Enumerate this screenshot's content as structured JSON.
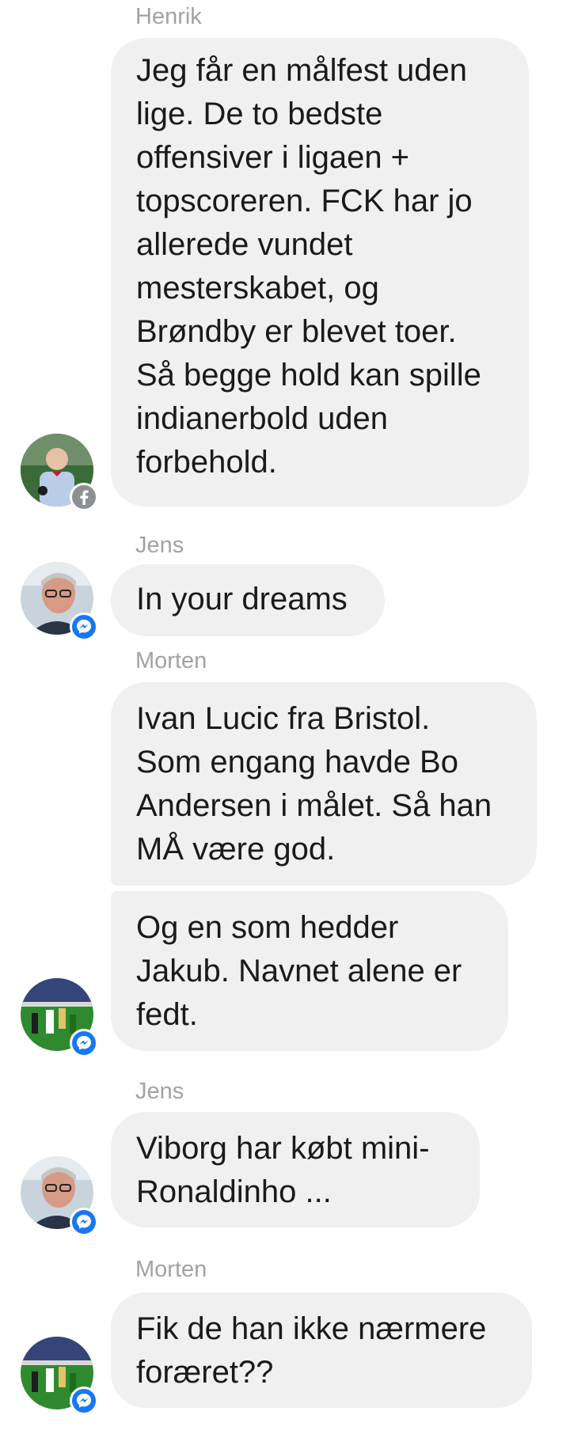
{
  "messages": [
    {
      "sender": "Henrik",
      "text": "Jeg får en målfest uden\nlige. De to bedste\noffensiver i ligaen +\ntopscoreren. FCK har jo\nallerede vundet\nmesterskabet, og\nBrøndby er blevet toer.\nSå begge hold kan spille\nindianerbold uden\nforbehold.",
      "badge": "facebook-icon"
    },
    {
      "sender": "Jens",
      "text": "In your dreams",
      "badge": "messenger-icon"
    },
    {
      "sender": "Morten",
      "text": "Ivan Lucic fra Bristol.\nSom engang havde Bo\nAndersen i målet. Så han\nMÅ være god."
    },
    {
      "text": "Og en som hedder\nJakub. Navnet alene er\nfedt.",
      "badge": "messenger-icon"
    },
    {
      "sender": "Jens",
      "text": "Viborg har købt mini-\nRonaldinho ...",
      "badge": "messenger-icon"
    },
    {
      "sender": "Morten",
      "text": "Fik de han ikke nærmere\nforæret??",
      "badge": "messenger-icon"
    }
  ],
  "colors": {
    "bubble": "#f0f0f0",
    "sender_name": "#a2a2a6",
    "messenger_badge": "#1877f2",
    "facebook_badge": "#8d8f93"
  }
}
